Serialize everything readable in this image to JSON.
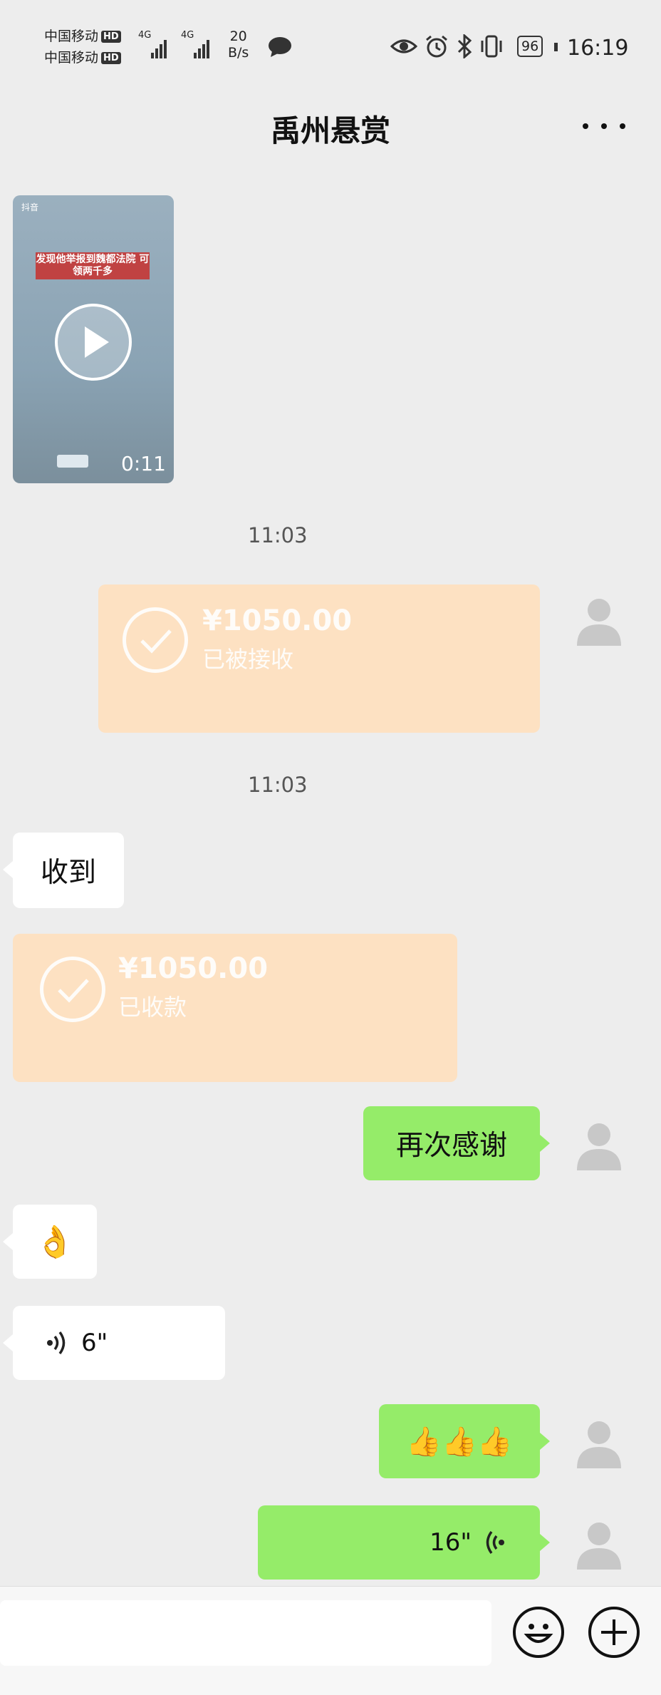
{
  "status_bar": {
    "carrier1": "中国移动",
    "carrier2": "中国移动",
    "hd": "HD",
    "net1": "4G",
    "net2": "4G",
    "speed_value": "20",
    "speed_unit": "B/s",
    "battery": "96",
    "time": "16:19"
  },
  "header": {
    "title": "禹州悬赏",
    "more_icon": "more-dots-icon"
  },
  "video": {
    "app_label": "抖音",
    "caption": "发现他举报到魏都法院 可领两千多",
    "duration": "0:11"
  },
  "timestamps": [
    "11:03",
    "11:03"
  ],
  "messages": {
    "transfer_sent": {
      "amount": "¥1050.00",
      "status": "已被接收"
    },
    "received_text": "收到",
    "transfer_received": {
      "amount": "¥1050.00",
      "status": "已收款"
    },
    "thanks": "再次感谢",
    "ok_emoji": "👌",
    "voice_in": "6\"",
    "thumbs": "👍👍👍",
    "voice_out": "16\""
  },
  "colors": {
    "background": "#ededed",
    "green_bubble": "#95ec69",
    "transfer": "#fde1c2"
  }
}
